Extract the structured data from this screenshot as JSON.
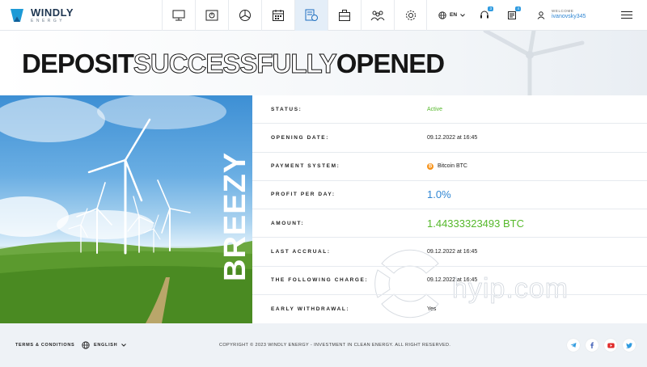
{
  "header": {
    "logo_name": "WINDLY",
    "logo_sub": "ENERGY",
    "nav": [
      {
        "icon": "monitor-icon",
        "active": false
      },
      {
        "icon": "safe-icon",
        "active": false
      },
      {
        "icon": "pie-chart-icon",
        "active": false
      },
      {
        "icon": "calendar-icon",
        "active": false
      },
      {
        "icon": "document-icon",
        "active": true
      },
      {
        "icon": "briefcase-icon",
        "active": false
      },
      {
        "icon": "users-icon",
        "active": false
      },
      {
        "icon": "gear-icon",
        "active": false
      }
    ],
    "language": "EN",
    "support_badge": "3",
    "news_badge": "4",
    "welcome_label": "WELCOME",
    "username": "ivanovsky345"
  },
  "title": {
    "part1": "DEPOSIT",
    "part2": "SUCCESSFULLY",
    "part3": "OPENED"
  },
  "hero": {
    "plan_name": "BREEZY"
  },
  "details": {
    "rows": [
      {
        "label": "STATUS:",
        "value": "Active"
      },
      {
        "label": "OPENING DATE:",
        "value": "09.12.2022 at 16:45"
      },
      {
        "label": "PAYMENT SYSTEM:",
        "value": "Bitcoin BTC"
      },
      {
        "label": "PROFIT PER DAY:",
        "value": "1.0%"
      },
      {
        "label": "AMOUNT:",
        "value": "1.44333323493 BTC"
      },
      {
        "label": "LAST ACCRUAL:",
        "value": "09.12.2022 at 16:45"
      },
      {
        "label": "THE FOLLOWING CHARGE:",
        "value": "09.12.2022 at 16:45"
      },
      {
        "label": "EARLY WITHDRAWAL:",
        "value": "Yes"
      }
    ],
    "btc_symbol": "₿"
  },
  "watermark": "hyip.com",
  "footer": {
    "terms": "TERMS & CONDITIONS",
    "language": "ENGLISH",
    "copyright": "COPYRIGHT © 2023 WINDLY ENERGY - INVESTMENT IN CLEAN ENERGY.  ALL RIGHT RESERVED."
  },
  "colors": {
    "accent_blue": "#2f86d3",
    "accent_green": "#55b82a",
    "dark": "#161616"
  }
}
